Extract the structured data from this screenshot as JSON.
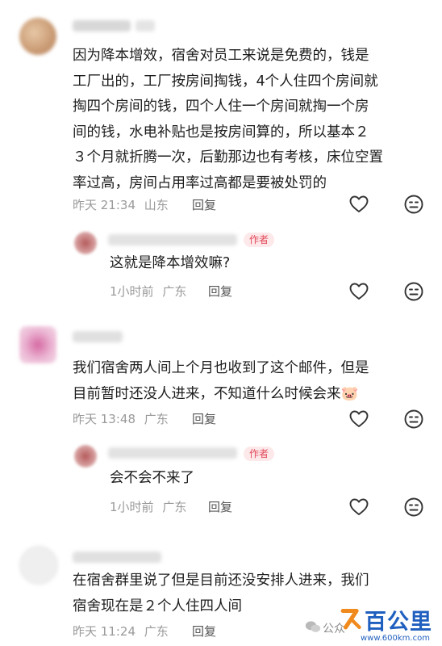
{
  "comments": [
    {
      "lines": [
        "因为降本增效，宿舍对员工来说是免费的，钱是",
        "工厂出的，工厂按房间掏钱，4个人住四个房间就",
        "掏四个房间的钱，四个人住一个房间就掏一个房",
        "间的钱，水电补贴也是按房间算的，所以基本２",
        "３个月就折腾一次，后勤那边也有考核，床位空置",
        "率过高，房间占用率过高都是要被处罚的"
      ],
      "time": "昨天 21:34",
      "location": "山东",
      "reply_label": "回复",
      "reply": {
        "author_tag": "作者",
        "text": "这就是降本增效嘛?",
        "time": "1小时前",
        "location": "广东",
        "reply_label": "回复"
      }
    },
    {
      "lines": [
        "我们宿舍两人间上个月也收到了这个邮件，但是",
        "目前暂时还没人进来，不知道什么时候会来🐷"
      ],
      "time": "昨天 13:48",
      "location": "广东",
      "reply_label": "回复",
      "reply": {
        "author_tag": "作者",
        "text": "会不会不来了",
        "time": "1小时前",
        "location": "广东",
        "reply_label": "回复"
      }
    },
    {
      "lines": [
        "在宿舍群里说了但是目前还没安排人进来，我们",
        "宿舍现在是２个人住四人间"
      ],
      "time": "昨天 11:24",
      "location": "广东",
      "reply_label": "回复"
    }
  ],
  "watermark": {
    "wechat_label": "公众",
    "brand": "百公里",
    "url": "www.600km.com"
  },
  "icons": [
    "heart-icon",
    "dislike-face-icon",
    "wechat-icon"
  ],
  "colors": {
    "author_tag_bg": "#fde8ea",
    "author_tag_text": "#e24a5a",
    "meta": "#9a9a9a",
    "brand_orange": "#f08a1c",
    "brand_blue": "#1f5fbf"
  }
}
